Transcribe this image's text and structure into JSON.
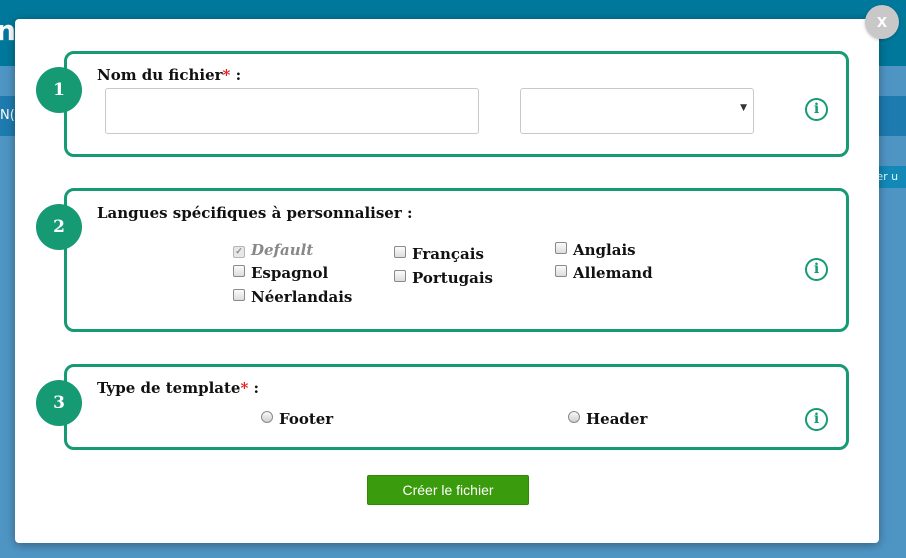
{
  "background": {
    "app_letter": "n",
    "left_fragment": "N(",
    "right_chip": "ter u"
  },
  "modal": {
    "close_label": "x",
    "sections": [
      {
        "step": "1",
        "title": "Nom du fichier",
        "required_mark": "*",
        "title_suffix": " :",
        "filename_value": "",
        "filename_placeholder": "",
        "extension_selected": "",
        "info_label": "i"
      },
      {
        "step": "2",
        "title": "Langues spécifiques à personnaliser :",
        "languages": [
          {
            "label": "Default",
            "checked": true,
            "disabled": true
          },
          {
            "label": "Français",
            "checked": false
          },
          {
            "label": "Anglais",
            "checked": false
          },
          {
            "label": "Espagnol",
            "checked": false
          },
          {
            "label": "Portugais",
            "checked": false
          },
          {
            "label": "Allemand",
            "checked": false
          },
          {
            "label": "Néerlandais",
            "checked": false
          }
        ],
        "info_label": "i"
      },
      {
        "step": "3",
        "title": "Type de template",
        "required_mark": "*",
        "title_suffix": " :",
        "options": [
          {
            "label": "Footer",
            "selected": false
          },
          {
            "label": "Header",
            "selected": false
          }
        ],
        "info_label": "i"
      }
    ],
    "create_button": "Créer le fichier"
  },
  "colors": {
    "accent_green": "#159a74",
    "button_green": "#3a9c0c",
    "required_red": "#e01b1b",
    "header_teal": "#00789b",
    "backdrop_blue": "#4f95c4"
  }
}
